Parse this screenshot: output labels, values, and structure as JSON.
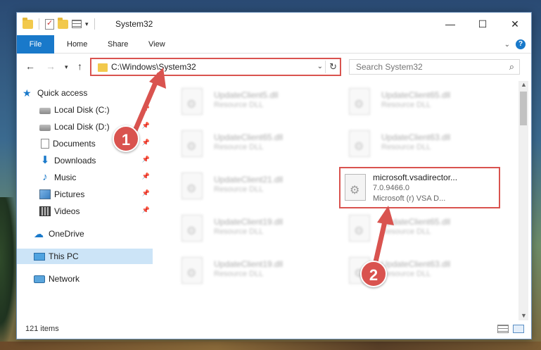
{
  "window": {
    "title": "System32",
    "controls": {
      "minimize": "—",
      "maximize": "☐",
      "close": "✕"
    }
  },
  "ribbon": {
    "tabs": [
      "File",
      "Home",
      "Share",
      "View"
    ],
    "help": "?"
  },
  "address": {
    "path": "C:\\Windows\\System32"
  },
  "search": {
    "placeholder": "Search System32"
  },
  "sidebar": {
    "items": [
      {
        "label": "Quick access",
        "icon": "star-icon"
      },
      {
        "label": "Local Disk (C:)",
        "icon": "drive-icon"
      },
      {
        "label": "Local Disk (D:)",
        "icon": "drive-icon"
      },
      {
        "label": "Documents",
        "icon": "documents-icon"
      },
      {
        "label": "Downloads",
        "icon": "download-icon"
      },
      {
        "label": "Music",
        "icon": "music-icon"
      },
      {
        "label": "Pictures",
        "icon": "pictures-icon"
      },
      {
        "label": "Videos",
        "icon": "videos-icon"
      },
      {
        "label": "OneDrive",
        "icon": "cloud-icon"
      },
      {
        "label": "This PC",
        "icon": "computer-icon"
      },
      {
        "label": "Network",
        "icon": "network-icon"
      }
    ]
  },
  "files": [
    {
      "name": "UpdateClient5.dll",
      "type": "Resource DLL"
    },
    {
      "name": "UpdateClient65.dll",
      "type": "Resource DLL"
    },
    {
      "name": "UpdateClient65.dll",
      "type": "Resource DLL"
    },
    {
      "name": "UpdateClient63.dll",
      "type": "Resource DLL"
    },
    {
      "name": "UpdateClient21.dll",
      "type": "Resource DLL"
    },
    {
      "name": "UpdateClient19.dll",
      "type": "Resource DLL"
    },
    {
      "name": "UpdateClient65.dll",
      "type": "Resource DLL"
    },
    {
      "name": "UpdateClient19.dll",
      "type": "Resource DLL"
    },
    {
      "name": "UpdateClient63.dll",
      "type": "Resource DLL"
    }
  ],
  "highlighted_file": {
    "name": "microsoft.vsadirector...",
    "version": "7.0.9466.0",
    "description": "Microsoft (r) VSA D..."
  },
  "status": {
    "item_count": "121 items"
  },
  "annotations": {
    "step1": "1",
    "step2": "2",
    "color": "#d9534f"
  }
}
